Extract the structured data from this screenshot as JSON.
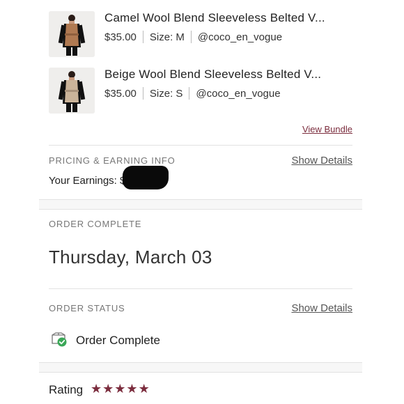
{
  "items": [
    {
      "title": "Camel Wool Blend Sleeveless Belted V...",
      "price": "$35.00",
      "size": "Size: M",
      "seller": "@coco_en_vogue",
      "image": "woman-camel-vest-photo"
    },
    {
      "title": "Beige Wool Blend Sleeveless Belted V...",
      "price": "$35.00",
      "size": "Size: S",
      "seller": "@coco_en_vogue",
      "image": "woman-beige-vest-photo"
    }
  ],
  "view_bundle": "View Bundle",
  "pricing": {
    "label": "PRICING & EARNING INFO",
    "show_details": "Show Details",
    "earnings_label": "Your Earnings: $"
  },
  "order_complete": {
    "label": "ORDER COMPLETE",
    "date": "Thursday, March 03"
  },
  "order_status": {
    "label": "ORDER STATUS",
    "show_details": "Show Details",
    "status": "Order Complete",
    "icon": "package-check-icon"
  },
  "rating": {
    "label": "Rating",
    "stars": 5,
    "star_glyph": "★"
  },
  "colors": {
    "accent": "#7b2c3d",
    "check": "#3aa757",
    "muted": "#777777"
  }
}
